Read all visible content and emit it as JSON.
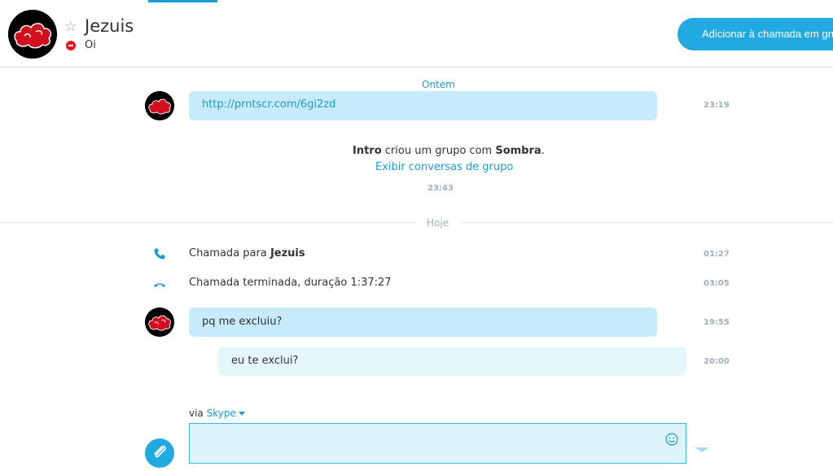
{
  "header": {
    "contact_name": "Jezuis",
    "status_text": "Oi",
    "add_to_call_label": "Adicionar à chamada em grupo"
  },
  "conversation": {
    "day_yesterday": "Ontem",
    "link_message": {
      "text": "http://prntscr.com/6gi2zd",
      "time": "23:19"
    },
    "group_event": {
      "actor": "Intro",
      "middle": " criou um grupo com ",
      "group": "Sombra",
      "end": ".",
      "link": "Exibir conversas de grupo",
      "time": "23:43"
    },
    "day_today": "Hoje",
    "call_to": {
      "prefix": "Chamada para ",
      "name": "Jezuis",
      "time": "01:27"
    },
    "call_ended": {
      "text": "Chamada terminada, duração 1:37:27",
      "time": "03:05"
    },
    "msg_in": {
      "text": "pq me excluiu?",
      "time": "19:55"
    },
    "msg_out": {
      "text": "eu te exclui?",
      "time": "20:00"
    }
  },
  "composer": {
    "via_prefix": "via ",
    "via_service": "Skype",
    "message_value": ""
  },
  "icons": {
    "favorite": "star-icon",
    "status": "do-not-disturb-icon",
    "call": "phone-icon",
    "call_end": "phone-hangup-icon",
    "emoji": "smiley-icon",
    "attach": "paperclip-icon",
    "send": "send-icon"
  },
  "colors": {
    "accent": "#1e9bd7",
    "button": "#21a9e1",
    "bubble_in": "#c7ebfa",
    "bubble_out": "#e5f6fd",
    "dnd": "#e81123"
  }
}
